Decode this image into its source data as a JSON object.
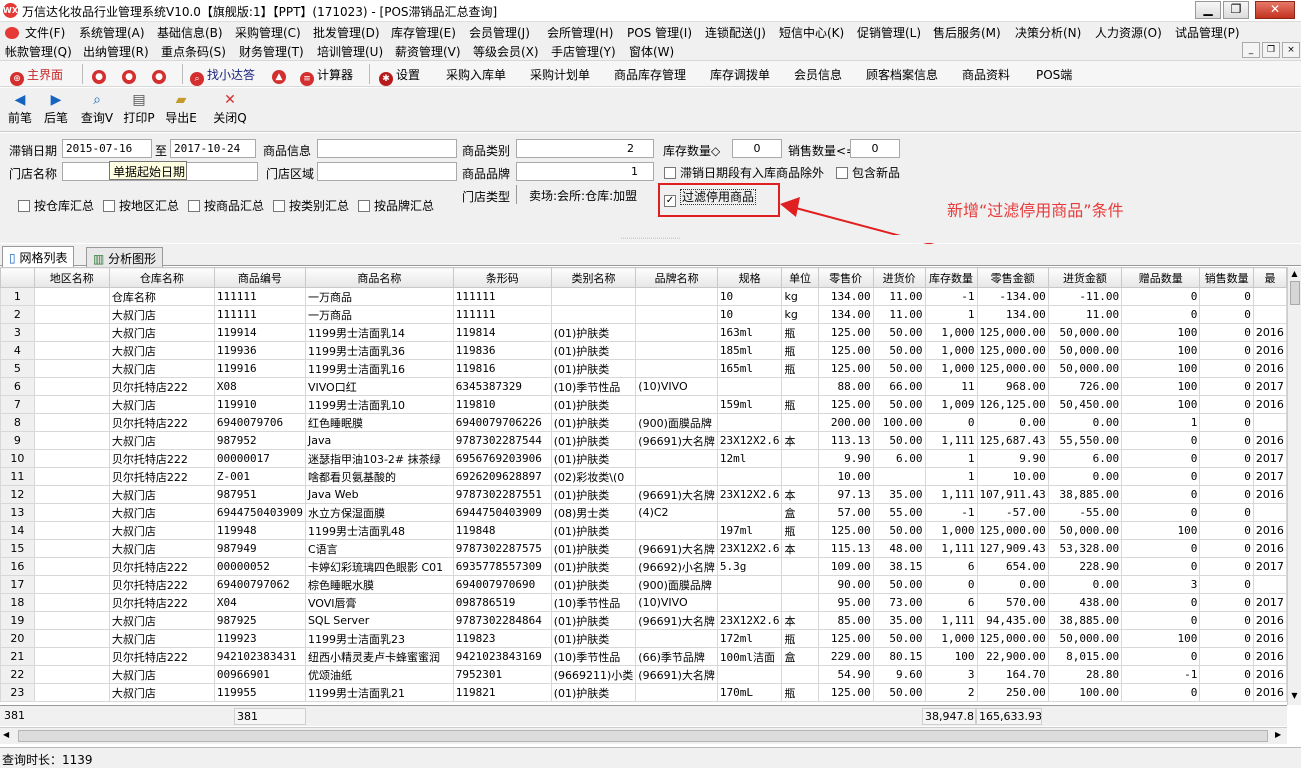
{
  "window": {
    "title": "万信达化妆品行业管理系统V10.0【旗舰版:1】【PPT】(171023) - [POS滞销品汇总查询]",
    "icon_text": "WX",
    "minimize": "▁",
    "restore": "❐",
    "close": "✕"
  },
  "menu": {
    "row1": [
      "文件(F)",
      "系统管理(A)",
      "基础信息(B)",
      "采购管理(C)",
      "批发管理(D)",
      "库存管理(E)",
      "会员管理(J)",
      "会所管理(H)",
      "POS 管理(I)",
      "连锁配送(J)",
      "短信中心(K)",
      "促销管理(L)",
      "售后服务(M)",
      "决策分析(N)",
      "人力资源(O)",
      "试品管理(P)"
    ],
    "row2": [
      "帐款管理(Q)",
      "出纳管理(R)",
      "重点条码(S)",
      "财务管理(T)",
      "培训管理(U)",
      "薪资管理(V)",
      "等级会员(X)",
      "手店管理(Y)",
      "窗体(W)"
    ],
    "mdi_min": "_",
    "mdi_restore": "❐",
    "mdi_close": "×"
  },
  "quickbar": {
    "home": "主界面",
    "find": "找小达答",
    "calculator": "计算器",
    "settings": "设置",
    "links": [
      "采购入库单",
      "采购计划单",
      "商品库存管理",
      "库存调拨单",
      "会员信息",
      "顾客档案信息",
      "商品资料",
      "POS端"
    ]
  },
  "toolbar": {
    "prev": "前笔",
    "next": "后笔",
    "query": "查询V",
    "print": "打印P",
    "export": "导出E",
    "close": "关闭Q"
  },
  "filters": {
    "date_label": "滞销日期",
    "date_from": "2015-07-16",
    "to_label": "至",
    "date_to": "2017-10-24",
    "product_info_label": "商品信息",
    "product_info": "",
    "category_label": "商品类别",
    "category_value": "2",
    "stock_qty_label": "库存数量◇",
    "stock_qty": "0",
    "sales_qty_label": "销售数量<=",
    "sales_qty": "0",
    "store_name_label": "门店名称",
    "tooltip": "单据起始日期",
    "store_area_label": "门店区域",
    "brand_label": "商品品牌",
    "brand_value": "1",
    "exclude_new_label": "滞销日期段有入库商品除外",
    "include_new_label": "包含新品",
    "store_type_label": "门店类型",
    "store_type_value": "卖场:会所:仓库:加盟",
    "filter_disabled_label": "过滤停用商品",
    "filter_disabled_checked": "✓",
    "group_options": [
      "按仓库汇总",
      "按地区汇总",
      "按商品汇总",
      "按类别汇总",
      "按品牌汇总"
    ]
  },
  "annotation": "新增“过滤停用商品”条件",
  "tabs": [
    "网格列表",
    "分析图形"
  ],
  "grid": {
    "columns": [
      "",
      "地区名称",
      "仓库名称",
      "商品编号",
      "商品名称",
      "条形码",
      "类别名称",
      "品牌名称",
      "规格",
      "单位",
      "零售价",
      "进货价",
      "库存数量",
      "零售金额",
      "进货金额",
      "赠品数量",
      "销售数量",
      "最"
    ],
    "rows": [
      [
        "1",
        "",
        "仓库名称",
        "111111",
        "一万商品",
        "111111",
        "",
        "",
        "10",
        "kg",
        "134.00",
        "11.00",
        "-1",
        "-134.00",
        "-11.00",
        "0",
        "0",
        ""
      ],
      [
        "2",
        "",
        "大叔门店",
        "111111",
        "一万商品",
        "111111",
        "",
        "",
        "10",
        "kg",
        "134.00",
        "11.00",
        "1",
        "134.00",
        "11.00",
        "0",
        "0",
        ""
      ],
      [
        "3",
        "",
        "大叔门店",
        "119914",
        "1199男士洁面乳14",
        "119814",
        "(01)护肤类",
        "",
        "163ml",
        "瓶",
        "125.00",
        "50.00",
        "1,000",
        "125,000.00",
        "50,000.00",
        "100",
        "0",
        "2016"
      ],
      [
        "4",
        "",
        "大叔门店",
        "119936",
        "1199男士洁面乳36",
        "119836",
        "(01)护肤类",
        "",
        "185ml",
        "瓶",
        "125.00",
        "50.00",
        "1,000",
        "125,000.00",
        "50,000.00",
        "100",
        "0",
        "2016"
      ],
      [
        "5",
        "",
        "大叔门店",
        "119916",
        "1199男士洁面乳16",
        "119816",
        "(01)护肤类",
        "",
        "165ml",
        "瓶",
        "125.00",
        "50.00",
        "1,000",
        "125,000.00",
        "50,000.00",
        "100",
        "0",
        "2016"
      ],
      [
        "6",
        "",
        "贝尔托特店222",
        "X08",
        "VIVO口红",
        "6345387329",
        "(10)季节性品",
        "(10)VIVO",
        "",
        "",
        "88.00",
        "66.00",
        "11",
        "968.00",
        "726.00",
        "100",
        "0",
        "2017"
      ],
      [
        "7",
        "",
        "大叔门店",
        "119910",
        "1199男士洁面乳10",
        "119810",
        "(01)护肤类",
        "",
        "159ml",
        "瓶",
        "125.00",
        "50.00",
        "1,009",
        "126,125.00",
        "50,450.00",
        "100",
        "0",
        "2016"
      ],
      [
        "8",
        "",
        "贝尔托特店222",
        "6940079706",
        "红色睡眠膜",
        "6940079706226",
        "(01)护肤类",
        "(900)面膜品牌",
        "",
        "",
        "200.00",
        "100.00",
        "0",
        "0.00",
        "0.00",
        "1",
        "0",
        ""
      ],
      [
        "9",
        "",
        "大叔门店",
        "987952",
        "Java",
        "9787302287544",
        "(01)护肤类",
        "(96691)大名牌",
        "23X12X2.6",
        "本",
        "113.13",
        "50.00",
        "1,111",
        "125,687.43",
        "55,550.00",
        "0",
        "0",
        "2016"
      ],
      [
        "10",
        "",
        "贝尔托特店222",
        "00000017",
        "迷瑟指甲油103-2# 抹茶绿",
        "6956769203906",
        "(01)护肤类",
        "",
        "12ml",
        "",
        "9.90",
        "6.00",
        "1",
        "9.90",
        "6.00",
        "0",
        "0",
        "2017"
      ],
      [
        "11",
        "",
        "贝尔托特店222",
        "Z-001",
        "啥都看贝氨基酸的",
        "6926209628897",
        "(02)彩妆类\\(0",
        "",
        "",
        "",
        "10.00",
        "",
        "1",
        "10.00",
        "0.00",
        "0",
        "0",
        "2017"
      ],
      [
        "12",
        "",
        "大叔门店",
        "987951",
        "Java Web",
        "9787302287551",
        "(01)护肤类",
        "(96691)大名牌",
        "23X12X2.6",
        "本",
        "97.13",
        "35.00",
        "1,111",
        "107,911.43",
        "38,885.00",
        "0",
        "0",
        "2016"
      ],
      [
        "13",
        "",
        "大叔门店",
        "6944750403909",
        "水立方保湿面膜",
        "6944750403909",
        "(08)男士类",
        "(4)C2",
        "",
        "盒",
        "57.00",
        "55.00",
        "-1",
        "-57.00",
        "-55.00",
        "0",
        "0",
        ""
      ],
      [
        "14",
        "",
        "大叔门店",
        "119948",
        "1199男士洁面乳48",
        "119848",
        "(01)护肤类",
        "",
        "197ml",
        "瓶",
        "125.00",
        "50.00",
        "1,000",
        "125,000.00",
        "50,000.00",
        "100",
        "0",
        "2016"
      ],
      [
        "15",
        "",
        "大叔门店",
        "987949",
        "C语言",
        "9787302287575",
        "(01)护肤类",
        "(96691)大名牌",
        "23X12X2.6",
        "本",
        "115.13",
        "48.00",
        "1,111",
        "127,909.43",
        "53,328.00",
        "0",
        "0",
        "2016"
      ],
      [
        "16",
        "",
        "贝尔托特店222",
        "00000052",
        "卡婷幻彩琉璃四色眼影 C01",
        "6935778557309",
        "(01)护肤类",
        "(96692)小名牌",
        "5.3g",
        "",
        "109.00",
        "38.15",
        "6",
        "654.00",
        "228.90",
        "0",
        "0",
        "2017"
      ],
      [
        "17",
        "",
        "贝尔托特店222",
        "69400797062",
        "棕色睡眠水膜",
        "694007970690",
        "(01)护肤类",
        "(900)面膜品牌",
        "",
        "",
        "90.00",
        "50.00",
        "0",
        "0.00",
        "0.00",
        "3",
        "0",
        ""
      ],
      [
        "18",
        "",
        "贝尔托特店222",
        "X04",
        "VOVI唇膏",
        "098786519",
        "(10)季节性品",
        "(10)VIVO",
        "",
        "",
        "95.00",
        "73.00",
        "6",
        "570.00",
        "438.00",
        "0",
        "0",
        "2017"
      ],
      [
        "19",
        "",
        "大叔门店",
        "987925",
        "SQL Server",
        "9787302284864",
        "(01)护肤类",
        "(96691)大名牌",
        "23X12X2.6",
        "本",
        "85.00",
        "35.00",
        "1,111",
        "94,435.00",
        "38,885.00",
        "0",
        "0",
        "2016"
      ],
      [
        "20",
        "",
        "大叔门店",
        "119923",
        "1199男士洁面乳23",
        "119823",
        "(01)护肤类",
        "",
        "172ml",
        "瓶",
        "125.00",
        "50.00",
        "1,000",
        "125,000.00",
        "50,000.00",
        "100",
        "0",
        "2016"
      ],
      [
        "21",
        "",
        "贝尔托特店222",
        "942102383431",
        "纽西小精灵麦卢卡蜂蜜蜜润",
        "9421023843169",
        "(10)季节性品",
        "(66)季节品牌",
        "100ml洁面",
        "盒",
        "229.00",
        "80.15",
        "100",
        "22,900.00",
        "8,015.00",
        "0",
        "0",
        "2016"
      ],
      [
        "22",
        "",
        "大叔门店",
        "00966901",
        "优颂油纸",
        "7952301",
        "(9669211)小类",
        "(96691)大名牌",
        "",
        "",
        "54.90",
        "9.60",
        "3",
        "164.70",
        "28.80",
        "-1",
        "0",
        "2016"
      ],
      [
        "23",
        "",
        "大叔门店",
        "119955",
        "1199男士洁面乳21",
        "119821",
        "(01)护肤类",
        "",
        "170mL",
        "瓶",
        "125.00",
        "50.00",
        "2",
        "250.00",
        "100.00",
        "0",
        "0",
        "2016"
      ]
    ]
  },
  "summary": {
    "row_count": "381",
    "code_count": "381",
    "stock_total": "38,947.8",
    "retail_total": "165,633.93"
  },
  "status": {
    "query_time": "查询时长：1139"
  }
}
